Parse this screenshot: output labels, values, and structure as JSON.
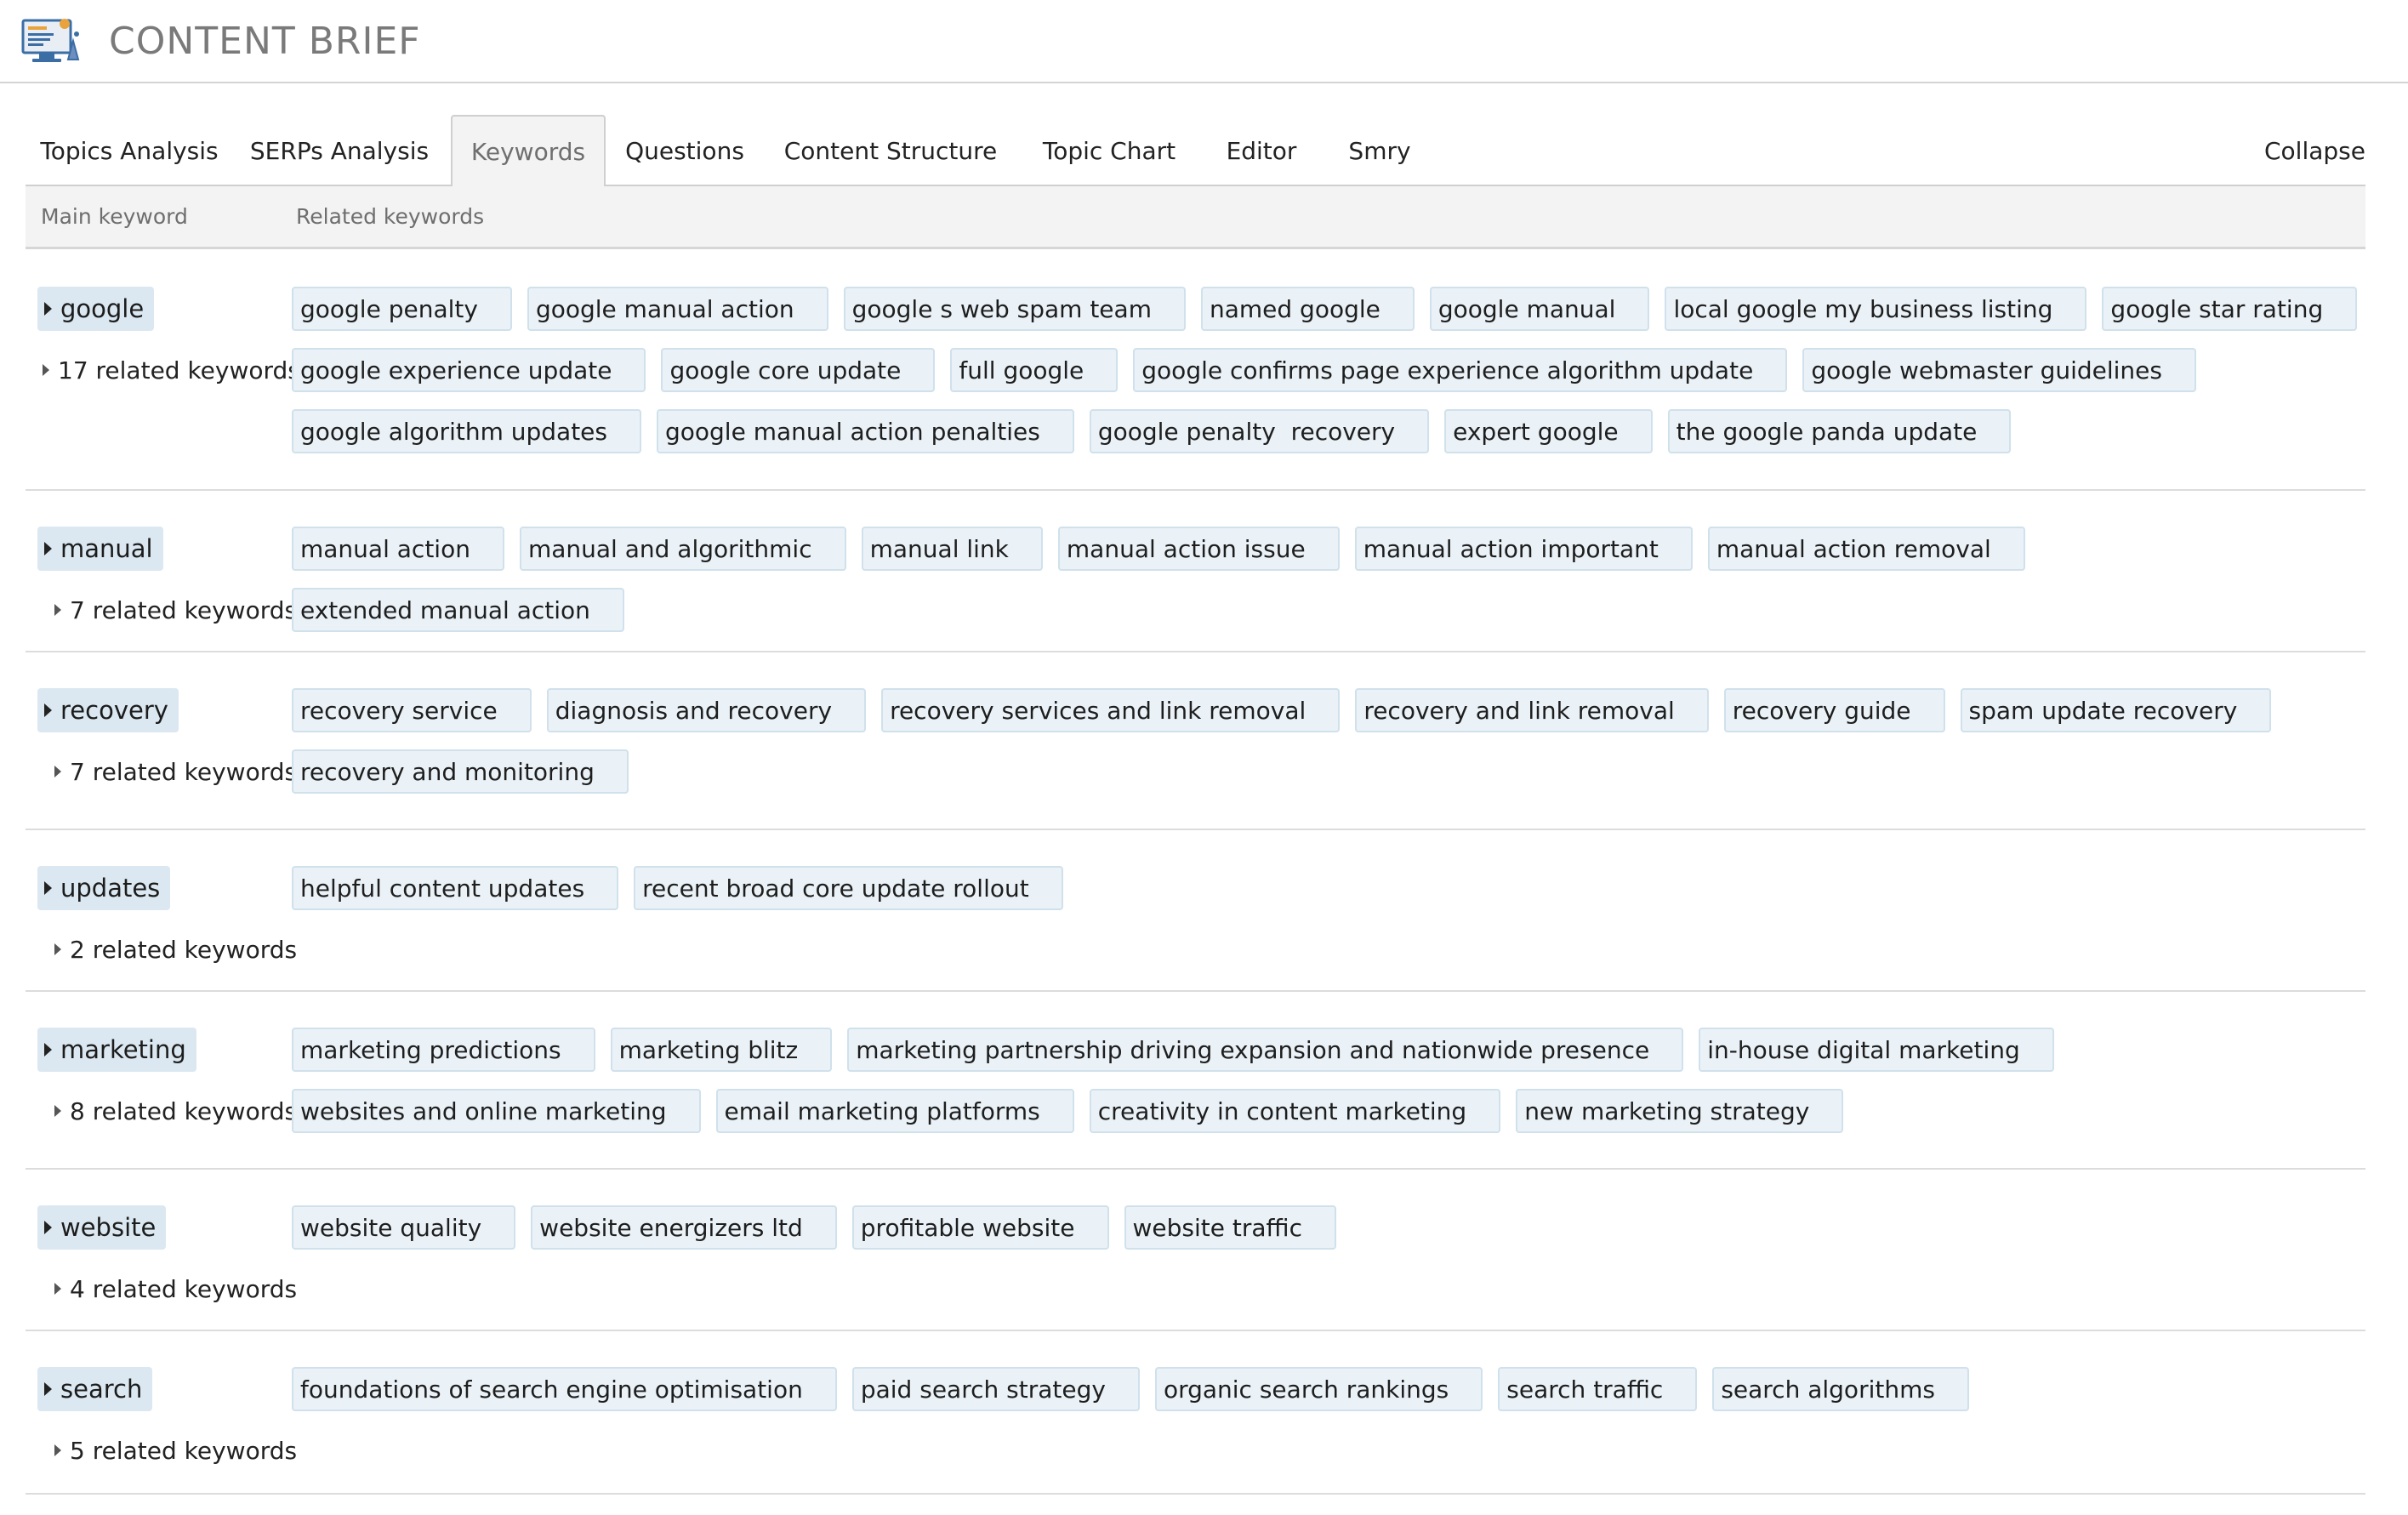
{
  "app": {
    "title": "CONTENT BRIEF",
    "logo_icon": "computer-monitor-icon"
  },
  "tabs": [
    {
      "label": "Topics Analysis",
      "active": false
    },
    {
      "label": "SERPs Analysis",
      "active": false
    },
    {
      "label": "Keywords",
      "active": true
    },
    {
      "label": "Questions",
      "active": false
    },
    {
      "label": "Content Structure",
      "active": false
    },
    {
      "label": "Topic Chart",
      "active": false
    },
    {
      "label": "Editor",
      "active": false
    },
    {
      "label": "Smry",
      "active": false
    }
  ],
  "collapse_label": "Collapse",
  "table": {
    "headers": {
      "main": "Main keyword",
      "related": "Related keywords"
    },
    "rows": [
      {
        "main": "google",
        "count_label": "17 related keywords",
        "related": [
          "google penalty",
          "google manual action",
          "google s web spam team",
          "named google",
          "google manual",
          "local google my business listing",
          "google star rating",
          "google experience update",
          "google core update",
          "full google",
          "google confirms page experience algorithm update",
          "google webmaster guidelines",
          "google algorithm updates",
          "google manual action penalties",
          "google penalty  recovery",
          "expert google",
          "the google panda update"
        ]
      },
      {
        "main": "manual",
        "count_label": "7 related keywords",
        "related": [
          "manual action",
          "manual and algorithmic",
          "manual link",
          "manual action issue",
          "manual action important",
          "manual action removal",
          "extended manual action"
        ]
      },
      {
        "main": "recovery",
        "count_label": "7 related keywords",
        "related": [
          "recovery service",
          "diagnosis and recovery",
          "recovery services and link removal",
          "recovery and link removal",
          "recovery guide",
          "spam update recovery",
          "recovery and monitoring"
        ]
      },
      {
        "main": "updates",
        "count_label": "2 related keywords",
        "related": [
          "helpful content updates",
          "recent broad core update rollout"
        ]
      },
      {
        "main": "marketing",
        "count_label": "8 related keywords",
        "related": [
          "marketing predictions",
          "marketing blitz",
          "marketing partnership driving expansion and nationwide presence",
          "in-house digital marketing",
          "websites and online marketing",
          "email marketing platforms",
          "creativity in content marketing",
          "new marketing strategy"
        ]
      },
      {
        "main": "website",
        "count_label": "4 related keywords",
        "related": [
          "website quality",
          "website energizers ltd",
          "profitable website",
          "website traffic"
        ]
      },
      {
        "main": "search",
        "count_label": "5 related keywords",
        "related": [
          "foundations of search engine optimisation",
          "paid search strategy",
          "organic search rankings",
          "search traffic",
          "search algorithms"
        ]
      }
    ]
  },
  "colors": {
    "chip_bg": "#eaf2f8",
    "chip_border": "#d0e1ec",
    "main_kw_bg": "#dbe8f1",
    "header_bg": "#f3f3f3",
    "title_gray": "#7a7a7a"
  }
}
